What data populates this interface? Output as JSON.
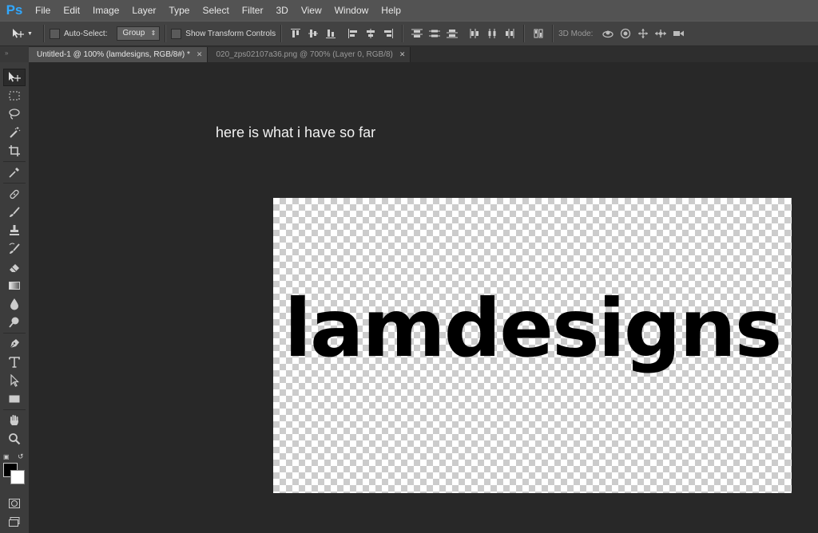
{
  "app": {
    "logo": "Ps"
  },
  "menu": [
    "File",
    "Edit",
    "Image",
    "Layer",
    "Type",
    "Select",
    "Filter",
    "3D",
    "View",
    "Window",
    "Help"
  ],
  "options": {
    "auto_select_label": "Auto-Select:",
    "auto_select_checked": false,
    "group_value": "Group",
    "show_transform_label": "Show Transform Controls",
    "show_transform_checked": false,
    "mode_3d_label": "3D Mode:"
  },
  "tabs": [
    {
      "label": "Untitled-1 @ 100% (lamdesigns, RGB/8#) *",
      "active": true
    },
    {
      "label": "020_zps02107a36.png @ 700% (Layer 0, RGB/8)",
      "active": false
    }
  ],
  "tools": [
    "move-tool-icon",
    "marquee-tool-icon",
    "lasso-tool-icon",
    "magic-wand-tool-icon",
    "crop-tool-icon",
    "eyedropper-tool-icon",
    "healing-brush-tool-icon",
    "brush-tool-icon",
    "clone-stamp-tool-icon",
    "history-brush-tool-icon",
    "eraser-tool-icon",
    "gradient-tool-icon",
    "blur-tool-icon",
    "dodge-tool-icon",
    "pen-tool-icon",
    "type-tool-icon",
    "path-selection-tool-icon",
    "rectangle-tool-icon",
    "hand-tool-icon",
    "zoom-tool-icon"
  ],
  "colors": {
    "foreground": "#000000",
    "background": "#ffffff",
    "accent": "#31a8ff"
  },
  "workspace": {
    "caption": "here is what i have so far",
    "canvas_text": "lamdesigns"
  }
}
